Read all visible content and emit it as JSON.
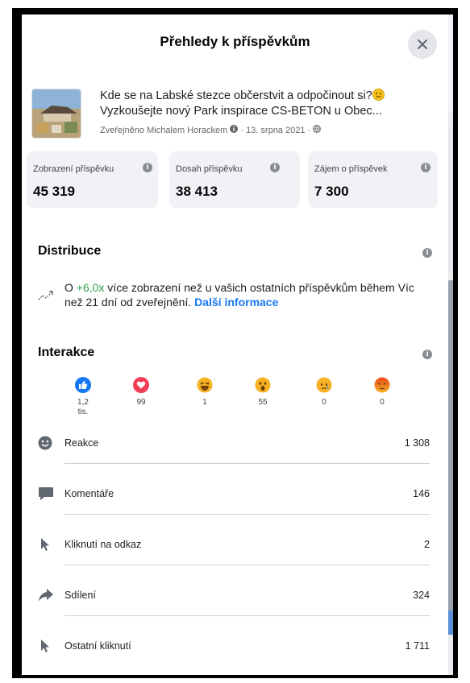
{
  "dialog": {
    "title": "Přehledy k příspěvkům"
  },
  "post": {
    "line1": "Kde se na Labské stezce občerstvit a odpočinout si?",
    "line2": "Vyzkoušejte nový Park inspirace CS-BETON u Obec...",
    "meta": "Zveřejněno Michalem Horackem",
    "meta_date": " · 13. srpna 2021 · "
  },
  "stats": [
    {
      "label": "Zobrazení příspěvku",
      "value": "45 319"
    },
    {
      "label": "Dosah příspěvku",
      "value": "38 413"
    },
    {
      "label": "Zájem o příspěvek",
      "value": "7 300"
    }
  ],
  "distribution": {
    "title": "Distribuce",
    "prefix": "O ",
    "multiplier": "+6,0x",
    "text": " více zobrazení než u vašich ostatních příspěvkům během Víc než 21 dní od zveřejnění. ",
    "link": "Další informace"
  },
  "interactions": {
    "title": "Interakce",
    "reactions": [
      {
        "icon": "like-icon",
        "count_line1": "1,2",
        "count_line2": "tis.",
        "color": "#1877f2"
      },
      {
        "icon": "love-icon",
        "count_line1": "99",
        "count_line2": "",
        "color": "#f33e58"
      },
      {
        "icon": "haha-icon",
        "count_line1": "1",
        "count_line2": "",
        "color": "#f7b125"
      },
      {
        "icon": "wow-icon",
        "count_line1": "55",
        "count_line2": "",
        "color": "#f7b125"
      },
      {
        "icon": "sad-icon",
        "count_line1": "0",
        "count_line2": "",
        "color": "#f7b125"
      },
      {
        "icon": "angry-icon",
        "count_line1": "0",
        "count_line2": "",
        "color": "#e9710f"
      }
    ],
    "rows": [
      {
        "icon": "smiley-icon",
        "label": "Reakce",
        "value": "1 308"
      },
      {
        "icon": "comment-icon",
        "label": "Komentáře",
        "value": "146"
      },
      {
        "icon": "cursor-icon",
        "label": "Kliknutí na odkaz",
        "value": "2"
      },
      {
        "icon": "share-icon",
        "label": "Sdílení",
        "value": "324"
      },
      {
        "icon": "cursor-icon",
        "label": "Ostatní kliknutí",
        "value": "1 711"
      }
    ]
  }
}
